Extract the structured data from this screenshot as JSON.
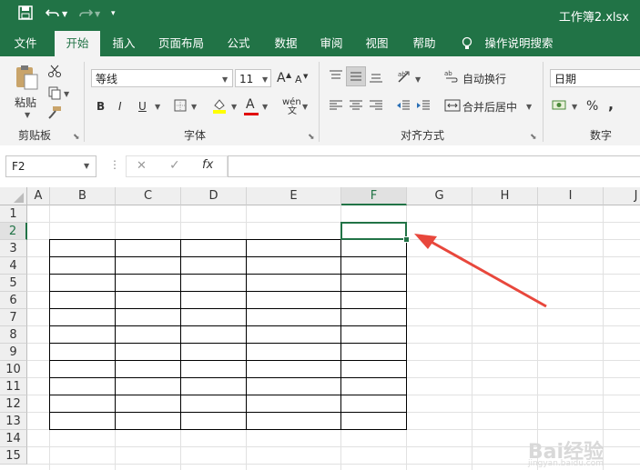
{
  "titlebar": {
    "filename": "工作簿2.xlsx",
    "qa_icons": [
      "save-icon",
      "undo-icon",
      "redo-icon",
      "customize-icon"
    ]
  },
  "tabs": [
    {
      "label": "文件"
    },
    {
      "label": "开始",
      "active": true
    },
    {
      "label": "插入"
    },
    {
      "label": "页面布局"
    },
    {
      "label": "公式"
    },
    {
      "label": "数据"
    },
    {
      "label": "审阅"
    },
    {
      "label": "视图"
    },
    {
      "label": "帮助"
    },
    {
      "label": "操作说明搜索"
    }
  ],
  "ribbon": {
    "clipboard": {
      "paste_label": "粘贴",
      "group_label": "剪贴板"
    },
    "font": {
      "font_name": "等线",
      "font_size": "11",
      "bold": "B",
      "italic": "I",
      "underline": "U",
      "grow": "A",
      "shrink": "A",
      "font_color_letter": "A",
      "phonetic": "wén",
      "group_label": "字体"
    },
    "alignment": {
      "wrap_label": "自动换行",
      "merge_label": "合并后居中",
      "group_label": "对齐方式"
    },
    "number": {
      "format": "日期",
      "percent": "%",
      "comma": ",",
      "group_label": "数字"
    }
  },
  "formula_bar": {
    "name_box": "F2",
    "cancel": "✕",
    "enter": "✓",
    "fx": "fx",
    "value": ""
  },
  "sheet": {
    "columns": [
      "A",
      "B",
      "C",
      "D",
      "E",
      "F",
      "G",
      "H",
      "I",
      "J"
    ],
    "rows": [
      "1",
      "2",
      "3",
      "4",
      "5",
      "6",
      "7",
      "8",
      "9",
      "10",
      "11",
      "12",
      "13",
      "14",
      "15"
    ],
    "selected_cell": "F2",
    "bordered_range": "B3:F13"
  },
  "colors": {
    "accent": "#217346",
    "arrow": "#e8473c"
  },
  "watermark": {
    "text": "Bai经验",
    "sub": "jingyan.baidu.com"
  }
}
